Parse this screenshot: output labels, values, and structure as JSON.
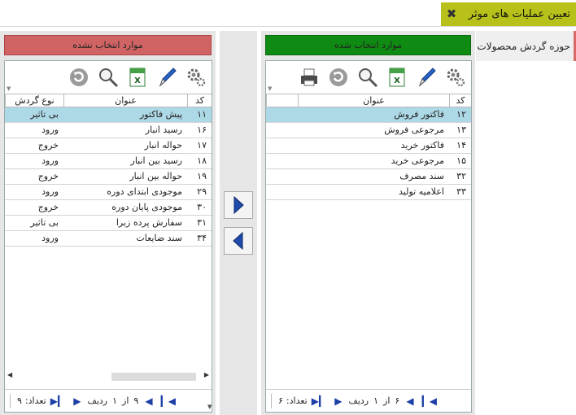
{
  "window": {
    "title": "تعیین عملیات های موثر",
    "close_glyph": "✖"
  },
  "side_tab": {
    "label": "حوزه گردش محصولات"
  },
  "selected_panel": {
    "header": "موارد انتخاب شده",
    "columns": {
      "code": "کد",
      "title": "عنوان"
    },
    "rows": [
      {
        "code": "۱۲",
        "title": "فاکتور فروش",
        "selected": true
      },
      {
        "code": "۱۳",
        "title": "مرجوعی فروش"
      },
      {
        "code": "۱۴",
        "title": "فاکتور خرید"
      },
      {
        "code": "۱۵",
        "title": "مرجوعی خرید"
      },
      {
        "code": "۳۲",
        "title": "سند مصرف"
      },
      {
        "code": "۳۳",
        "title": "اعلامیه تولید"
      }
    ],
    "pager": {
      "count_label": "تعداد:",
      "count": "۶",
      "row_label": "ردیف",
      "current": "۱",
      "of_label": "از",
      "total": "۶"
    }
  },
  "unselected_panel": {
    "header": "موارد انتخاب نشده",
    "columns": {
      "code": "کد",
      "title": "عنوان",
      "type": "نوع گردش"
    },
    "rows": [
      {
        "code": "۱۱",
        "title": "پیش فاکتور",
        "type": "بی تاثیر",
        "selected": true
      },
      {
        "code": "۱۶",
        "title": "رسید انبار",
        "type": "ورود"
      },
      {
        "code": "۱۷",
        "title": "حواله انبار",
        "type": "خروج"
      },
      {
        "code": "۱۸",
        "title": "رسید بین انبار",
        "type": "ورود"
      },
      {
        "code": "۱۹",
        "title": "حواله بین انبار",
        "type": "خروج"
      },
      {
        "code": "۲۹",
        "title": "موجودی ابتدای دوره",
        "type": "ورود"
      },
      {
        "code": "۳۰",
        "title": "موجودی پایان دوره",
        "type": "خروج"
      },
      {
        "code": "۳۱",
        "title": "سفارش پرده زبرا",
        "type": "بی تاثیر"
      },
      {
        "code": "۳۴",
        "title": "سند ضایعات",
        "type": "ورود"
      }
    ],
    "pager": {
      "count_label": "تعداد:",
      "count": "۹",
      "row_label": "ردیف",
      "current": "۱",
      "of_label": "از",
      "total": "۹"
    }
  },
  "icons": {
    "toolbar_selected": [
      "gear-icon",
      "pen-icon",
      "excel-icon",
      "search-icon",
      "refresh-icon",
      "printer-icon"
    ],
    "toolbar_unselected": [
      "gear-icon",
      "pen-icon",
      "excel-icon",
      "search-icon",
      "refresh-icon"
    ],
    "move": [
      "move-right-icon",
      "move-left-icon"
    ]
  },
  "colors": {
    "title_bg": "#b7c11a",
    "selected_header": "#0f8a12",
    "unselected_header": "#d06464",
    "row_selected": "#add8e6",
    "nav": "#1c3fa8"
  }
}
